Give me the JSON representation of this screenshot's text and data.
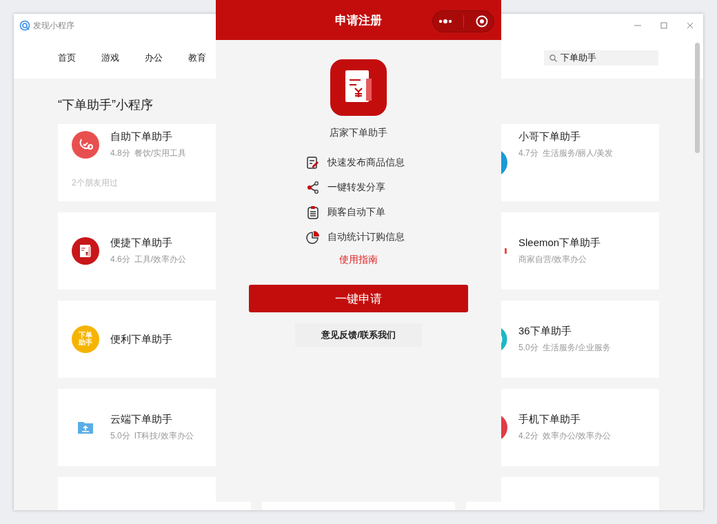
{
  "window": {
    "title": "发现小程序"
  },
  "nav": {
    "tabs": [
      {
        "label": "首页"
      },
      {
        "label": "游戏"
      },
      {
        "label": "办公"
      },
      {
        "label": "教育"
      }
    ],
    "search": {
      "value": "下单助手"
    }
  },
  "section_title": "“下单助手”小程序",
  "left_cards": [
    {
      "name": "自助下单助手",
      "rating": "4.8分",
      "category": "餐饮/实用工具",
      "friends": "2个朋友用过",
      "icon": {
        "kind": "bell",
        "color": "#e8504f"
      }
    },
    {
      "name": "便捷下单助手",
      "rating": "4.6分",
      "category": "工具/效率办公",
      "icon": {
        "kind": "receipt",
        "color": "#c8171b"
      }
    },
    {
      "name": "便利下单助手",
      "icon": {
        "kind": "badge",
        "color": "#f5b400",
        "text": "下单助手"
      }
    },
    {
      "name": "云端下单助手",
      "rating": "5.0分",
      "category": "IT科技/效率办公",
      "icon": {
        "kind": "folder",
        "color": "#5aaee6"
      }
    }
  ],
  "right_cards": [
    {
      "name": "小哥下单助手",
      "rating": "4.7分",
      "category": "生活服务/丽人/美发",
      "icon": {
        "kind": "disc",
        "color": "#1a9ad6"
      }
    },
    {
      "name": "Sleemon下单助手",
      "category": "商家自营/效率办公",
      "icon": {
        "kind": "mark",
        "color": "#e8504f"
      }
    },
    {
      "name": "36下单助手",
      "rating": "5.0分",
      "category": "生活服务/企业服务",
      "icon": {
        "kind": "ring",
        "color": "#1bb8c4"
      }
    },
    {
      "name": "手机下单助手",
      "rating": "4.2分",
      "category": "效率办公/效率办公",
      "icon": {
        "kind": "disc",
        "color": "#e03c46"
      }
    }
  ],
  "overlay": {
    "title": "申请注册",
    "app_name": "店家下单助手",
    "features": [
      {
        "kind": "edit",
        "text": "快速发布商品信息"
      },
      {
        "kind": "share",
        "text": "一键转发分享"
      },
      {
        "kind": "clipboard",
        "text": "顾客自动下单"
      },
      {
        "kind": "pie",
        "text": "自动统计订购信息"
      }
    ],
    "guide_link": "使用指南",
    "apply_button": "一键申请",
    "feedback_button": "意见反馈/联系我们"
  }
}
